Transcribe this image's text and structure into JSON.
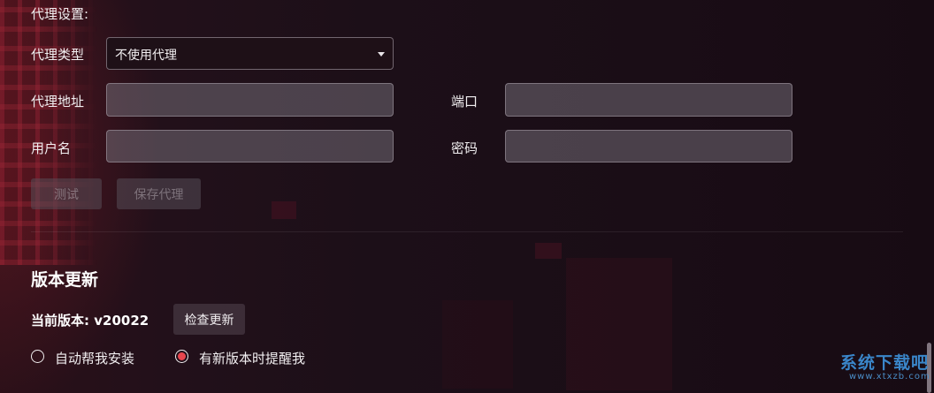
{
  "proxy": {
    "section_label": "代理设置:",
    "type_label": "代理类型",
    "type_value": "不使用代理",
    "address_label": "代理地址",
    "address_value": "",
    "port_label": "端口",
    "port_value": "",
    "username_label": "用户名",
    "username_value": "",
    "password_label": "密码",
    "password_value": "",
    "test_button": "测试",
    "save_button": "保存代理"
  },
  "update": {
    "title": "版本更新",
    "current_version_label": "当前版本:",
    "current_version_value": "v20022",
    "check_button": "检查更新",
    "options": [
      {
        "label": "自动帮我安装",
        "selected": false
      },
      {
        "label": "有新版本时提醒我",
        "selected": true
      }
    ]
  },
  "watermark": {
    "main": "系统下载吧",
    "sub": "www.xtxzb.com"
  },
  "colors": {
    "radio_selected": "#e8464e",
    "watermark": "#3a86c9"
  }
}
